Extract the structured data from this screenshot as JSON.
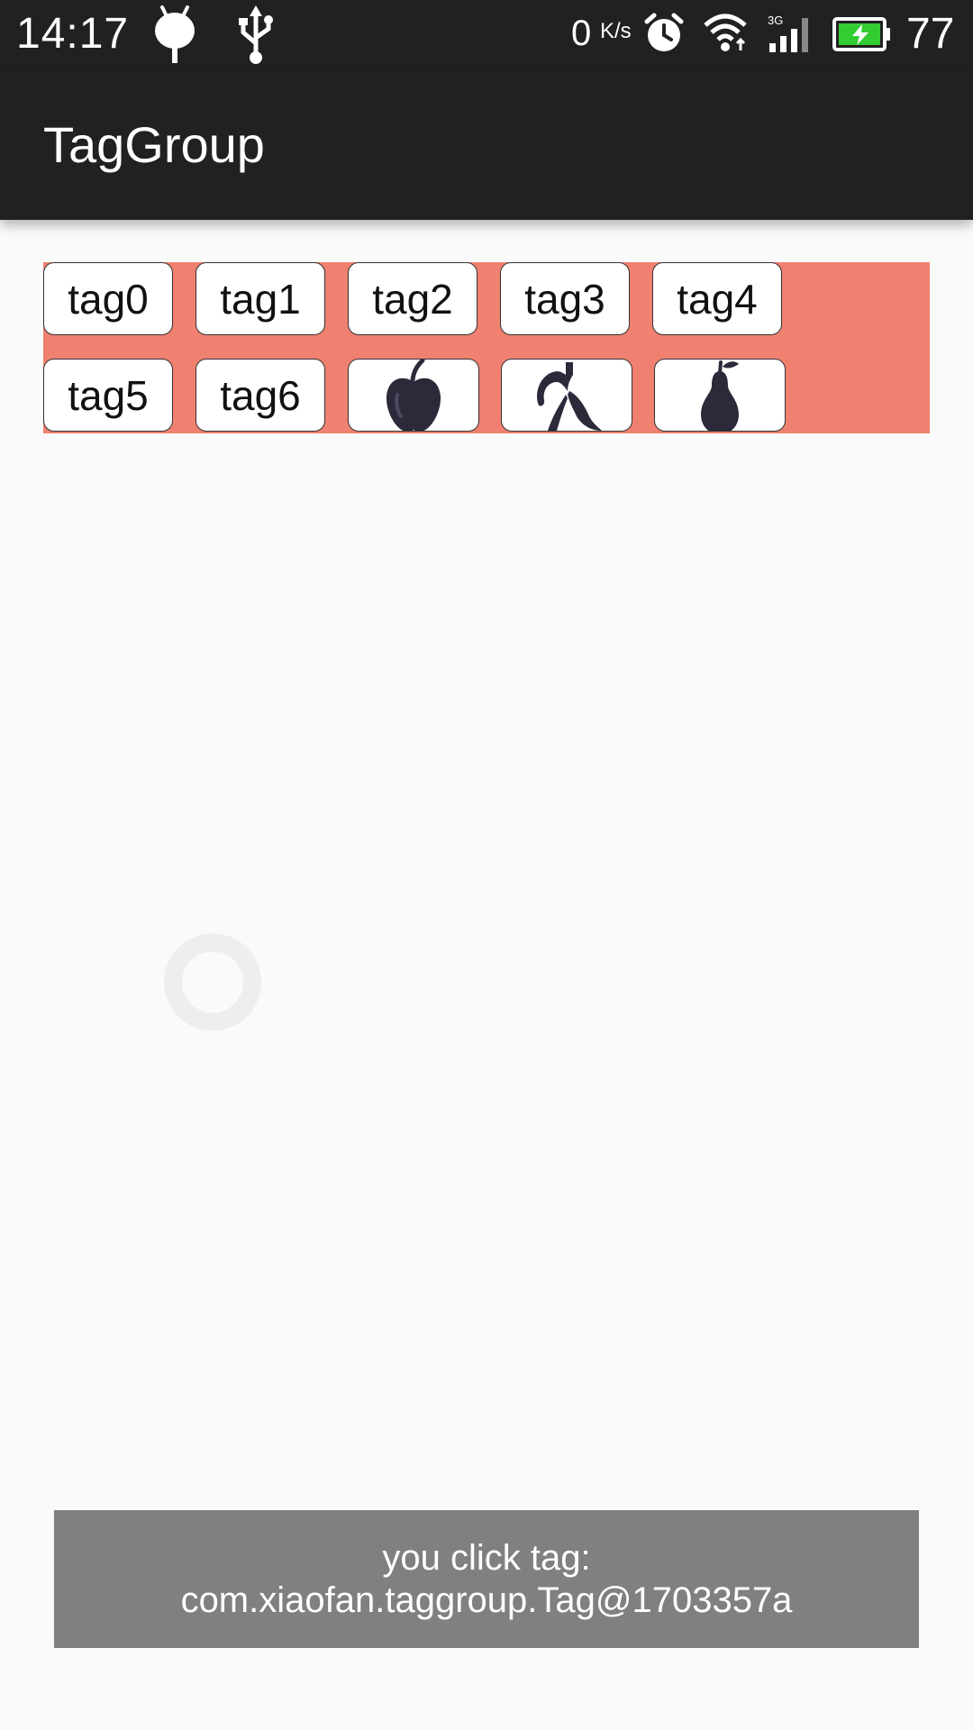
{
  "status_bar": {
    "time": "14:17",
    "network_speed": "0",
    "network_speed_unit": "K/s",
    "battery_level": "77",
    "icons": [
      "android-debug-icon",
      "usb-icon",
      "alarm-icon",
      "wifi-icon",
      "signal-3g-icon",
      "battery-charging-icon"
    ],
    "battery_color": "#33cc33"
  },
  "toolbar": {
    "title": "TagGroup",
    "background": "#212121"
  },
  "tag_group": {
    "background": "#f08070",
    "text_tags": [
      "tag0",
      "tag1",
      "tag2",
      "tag3",
      "tag4",
      "tag5",
      "tag6"
    ],
    "image_tags": [
      "apple-icon",
      "banana-icon",
      "pear-icon"
    ]
  },
  "toast": {
    "line1": "you click tag:",
    "line2": "com.xiaofan.taggroup.Tag@1703357a"
  }
}
